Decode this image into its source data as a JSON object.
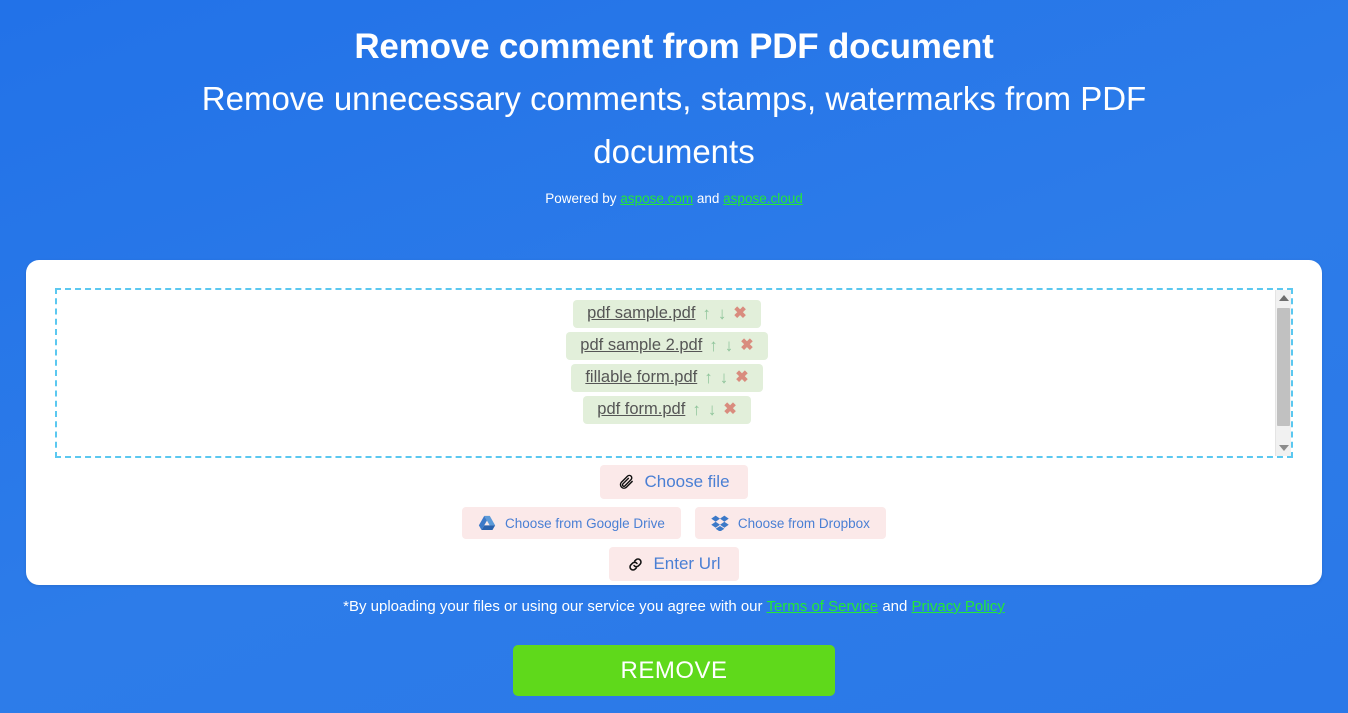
{
  "header": {
    "title": "Remove comment from PDF document",
    "subtitle": "Remove unnecessary comments, stamps, watermarks from PDF documents",
    "powered_prefix": "Powered by",
    "powered_link1": "aspose.com",
    "powered_conjunction": "and",
    "powered_link2": "aspose.cloud"
  },
  "dropzone": {
    "files": [
      {
        "name": "pdf sample.pdf",
        "move_up": "↑",
        "move_down": "↓",
        "remove": "✖"
      },
      {
        "name": "pdf sample 2.pdf",
        "move_up": "↑",
        "move_down": "↓",
        "remove": "✖"
      },
      {
        "name": "fillable form.pdf",
        "move_up": "↑",
        "move_down": "↓",
        "remove": "✖"
      },
      {
        "name": "pdf form.pdf",
        "move_up": "↑",
        "move_down": "↓",
        "remove": "✖"
      }
    ],
    "scrollbar": {
      "up": "▲",
      "down": "▼"
    }
  },
  "upload": {
    "choose_file": "Choose file",
    "google_drive": "Choose from Google Drive",
    "dropbox": "Choose from Dropbox",
    "enter_url": "Enter Url",
    "paperclip_glyph": "🖇",
    "link_glyph": "🔗"
  },
  "terms": {
    "prefix": "*By uploading your files or using our service you agree with our",
    "link1": "Terms of Service",
    "conjunction": "and",
    "link2": "Privacy Policy"
  },
  "action": {
    "remove_label": "REMOVE"
  },
  "colors": {
    "background_blue": "#2272e8",
    "accent_green": "#5fd91b",
    "link_green": "#23e836",
    "chip_green": "#e2efda",
    "button_pink": "#fbe9e9",
    "button_text_blue": "#4a7fd4",
    "dashed_border": "#5bc8f0"
  }
}
